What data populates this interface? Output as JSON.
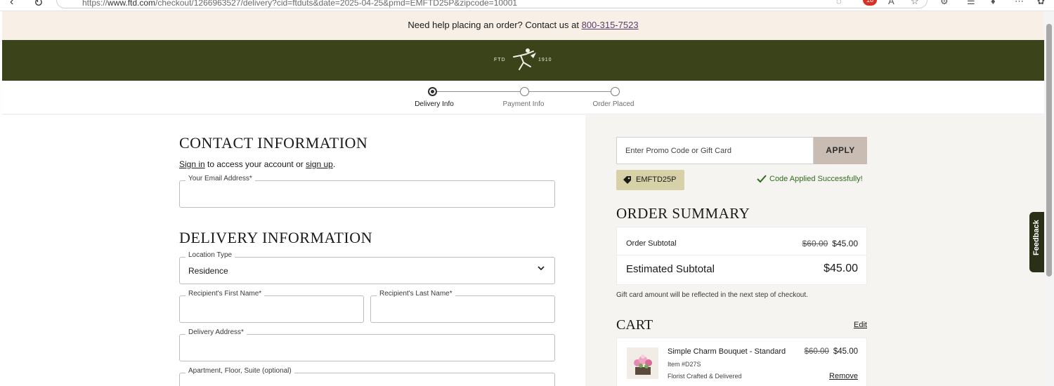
{
  "browser": {
    "url_prefix": "https://",
    "url_host": "www.ftd.com",
    "url_path": "/checkout/1266963527/delivery?cid=ftduts&date=2025-04-25&pmd=EMFTD25P&zipcode=10001",
    "extension_badge": "16"
  },
  "help_bar": {
    "text": "Need help placing an order? Contact us at ",
    "phone": "800-315-7523"
  },
  "brand": {
    "left_text": "FTD",
    "right_text": "1910"
  },
  "steps": [
    {
      "label": "Delivery Info",
      "active": true
    },
    {
      "label": "Payment Info",
      "active": false
    },
    {
      "label": "Order Placed",
      "active": false
    }
  ],
  "contact": {
    "title": "CONTACT INFORMATION",
    "sign_in": "Sign in",
    "middle_text": " to access your account or ",
    "sign_up": "sign up",
    "end_text": ".",
    "email_label": "Your Email Address*"
  },
  "delivery": {
    "title": "DELIVERY INFORMATION",
    "location_label": "Location Type",
    "location_value": "Residence",
    "first_name_label": "Recipient's First Name*",
    "last_name_label": "Recipient's Last Name*",
    "address_label": "Delivery Address*",
    "apartment_label": "Apartment, Floor, Suite (optional)"
  },
  "promo": {
    "placeholder": "Enter Promo Code or Gift Card",
    "apply_label": "APPLY",
    "applied_code": "EMFTD25P",
    "success_text": "Code Applied Successfully!"
  },
  "summary": {
    "title": "ORDER SUMMARY",
    "subtotal_label": "Order Subtotal",
    "subtotal_original": "$60.00",
    "subtotal_price": "$45.00",
    "estimated_label": "Estimated Subtotal",
    "estimated_price": "$45.00",
    "gift_note": "Gift card amount will be reflected in the next step of checkout."
  },
  "cart": {
    "title": "CART",
    "edit_label": "Edit",
    "item_name": "Simple Charm Bouquet - Standard",
    "item_original_price": "$60.00",
    "item_price": "$45.00",
    "item_number": "Item #D27S",
    "item_note": "Florist Crafted & Delivered",
    "remove_label": "Remove"
  },
  "feedback": {
    "label": "Feedback"
  },
  "colors": {
    "brand_green": "#3a4319",
    "banner_cream": "#f8f0e6",
    "apply_button": "#c9bcb2",
    "code_chip": "#d7d1a8",
    "success_green": "#2f6b1f"
  }
}
